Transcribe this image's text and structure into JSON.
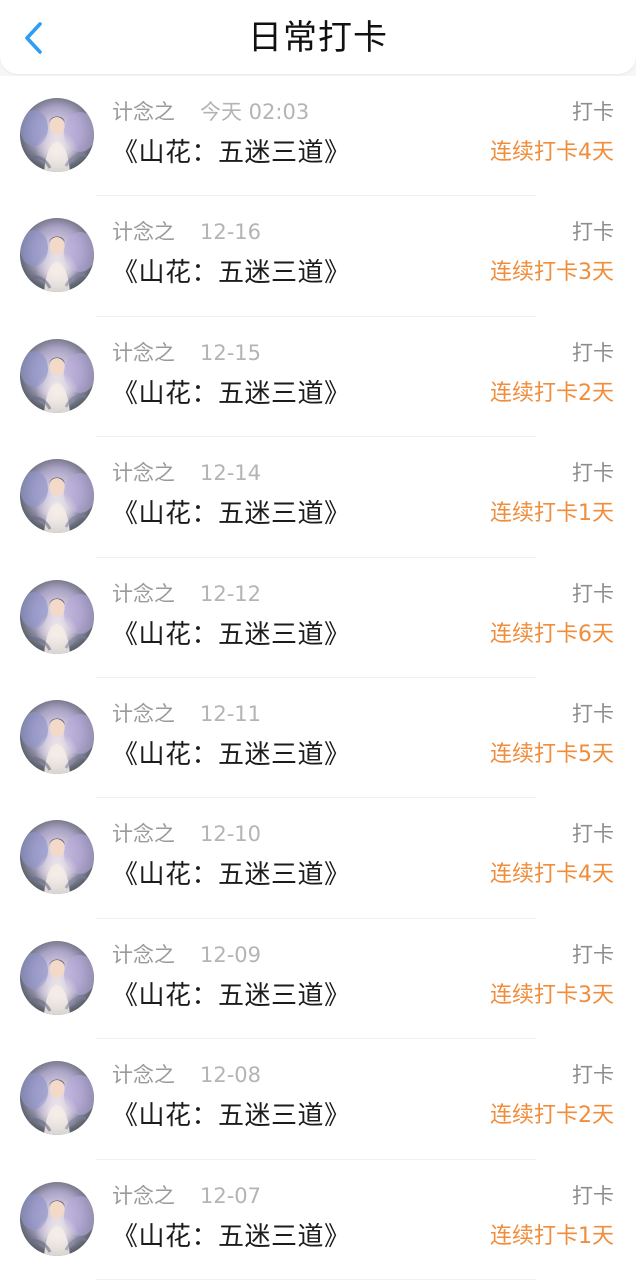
{
  "header": {
    "title": "日常打卡",
    "back_icon": "chevron-left-icon",
    "accent_color": "#2f9df4"
  },
  "streak_color": "#f08c3a",
  "entries": [
    {
      "name": "计念之",
      "time": "今天 02:03",
      "book": "《山花：五迷三道》",
      "action": "打卡",
      "streak": "连续打卡4天"
    },
    {
      "name": "计念之",
      "time": "12-16",
      "book": "《山花：五迷三道》",
      "action": "打卡",
      "streak": "连续打卡3天"
    },
    {
      "name": "计念之",
      "time": "12-15",
      "book": "《山花：五迷三道》",
      "action": "打卡",
      "streak": "连续打卡2天"
    },
    {
      "name": "计念之",
      "time": "12-14",
      "book": "《山花：五迷三道》",
      "action": "打卡",
      "streak": "连续打卡1天"
    },
    {
      "name": "计念之",
      "time": "12-12",
      "book": "《山花：五迷三道》",
      "action": "打卡",
      "streak": "连续打卡6天"
    },
    {
      "name": "计念之",
      "time": "12-11",
      "book": "《山花：五迷三道》",
      "action": "打卡",
      "streak": "连续打卡5天"
    },
    {
      "name": "计念之",
      "time": "12-10",
      "book": "《山花：五迷三道》",
      "action": "打卡",
      "streak": "连续打卡4天"
    },
    {
      "name": "计念之",
      "time": "12-09",
      "book": "《山花：五迷三道》",
      "action": "打卡",
      "streak": "连续打卡3天"
    },
    {
      "name": "计念之",
      "time": "12-08",
      "book": "《山花：五迷三道》",
      "action": "打卡",
      "streak": "连续打卡2天"
    },
    {
      "name": "计念之",
      "time": "12-07",
      "book": "《山花：五迷三道》",
      "action": "打卡",
      "streak": "连续打卡1天"
    }
  ]
}
